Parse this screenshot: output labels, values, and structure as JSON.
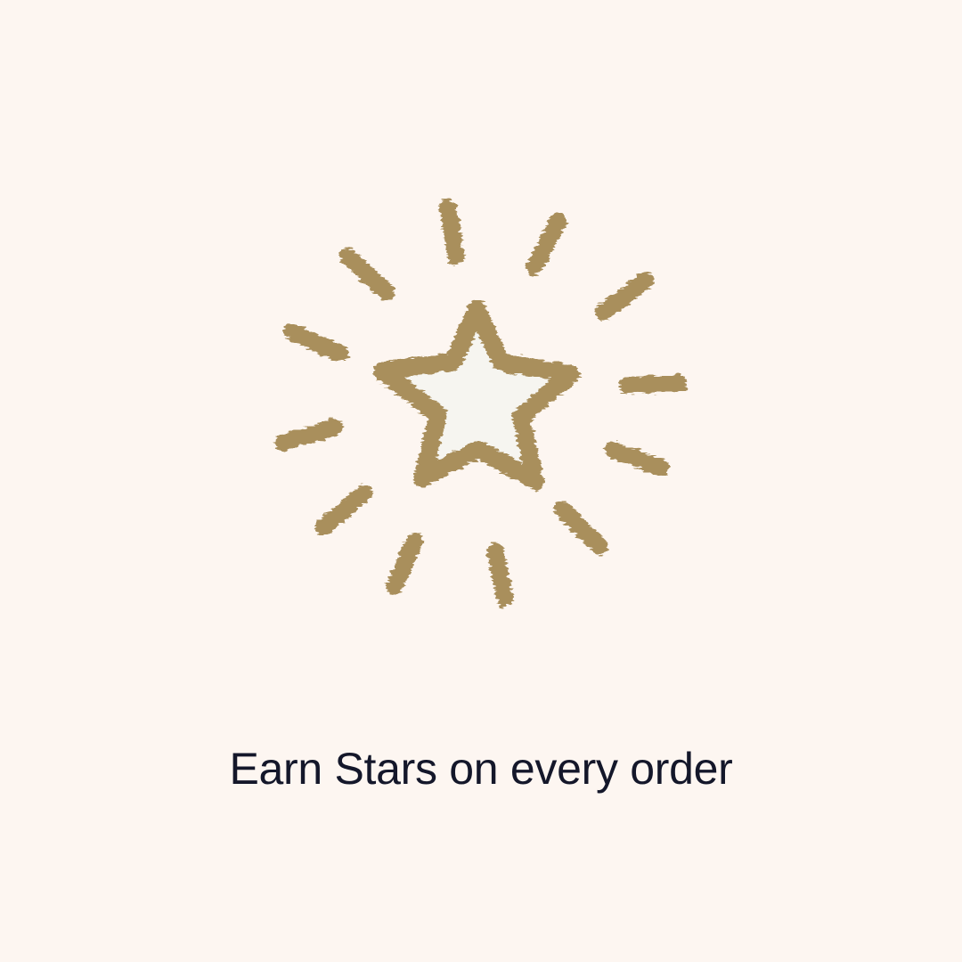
{
  "caption": "Earn Stars on every order",
  "illustration": {
    "icon": "sparkling-star-icon",
    "ray_count": 12
  },
  "colors": {
    "background": "#fdf6f1",
    "gold": "#a98f5c",
    "star_fill": "#f6f5f0",
    "text": "#14172a"
  }
}
